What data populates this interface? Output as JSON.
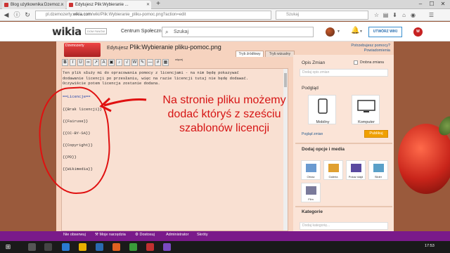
{
  "browser": {
    "tabs": [
      {
        "label": "Blog użytkownika:Dzemoz...",
        "active": false
      },
      {
        "label": "Edytujesz Plik:Wybieranie ...",
        "active": true
      }
    ],
    "newtab": "+",
    "window_min": "–",
    "window_max": "☐",
    "window_close": "✕",
    "url_prefix": "pl.dzemozerty.",
    "url_host": "wikia.com",
    "url_path": "/wiki/Plik:Wybieranie_pliku-pomoc.png?action=edit",
    "search_placeholder": "Szukaj"
  },
  "wikia": {
    "logo": "wikia",
    "fandom": "DOM FANÓW",
    "community": "Centrum Społeczności",
    "search_placeholder": "Szukaj",
    "create_button": "UTWÓRZ WIKI",
    "wikia_badge": "W"
  },
  "editor": {
    "wiki_thumb": "Dżemozerty",
    "editing_prefix": "Edytujesz",
    "page_title": "Plik:Wybieranie pliku-pomoc.png",
    "help1": "Potrzebujesz pomocy?",
    "help2": "Powiadomienia",
    "mode_source": "Tryb źródłowy",
    "mode_visual": "Tryb wizualny",
    "more": "więcej",
    "intro_lines": [
      "Ten plik służy mi do opracowania pomocy z licencjami - na nim będę pokazywać",
      "dodawanie licencji po przesłaniu, więc na razie licencji tutaj nie będę dodawać.",
      "Oczywiście potem licencja zostanie dodana."
    ],
    "heading": "==Licencje==",
    "licenses": [
      "{{Brak licencji}}",
      "{{Fairuse}}",
      "{{CC-BY-SA}}",
      "{{Copyright}}",
      "{{PD}}",
      "{{Wikimedia}}"
    ]
  },
  "annotation": {
    "lines": [
      "Na stronie pliku możemy",
      "dodać któryś z sześciu",
      "szablonów licencji"
    ]
  },
  "sidebar": {
    "summary_label": "Opis Zmian",
    "minor_label": "Drobna zmiana",
    "summary_placeholder": "Dodaj opis zmian",
    "preview_label": "Podgląd",
    "mobile": "Mobilny",
    "desktop": "Komputer",
    "preview_link": "Pogląd zmian",
    "publish": "Publikuj",
    "add_media": "Dodaj opcje i media",
    "media": [
      {
        "label": "Obraz",
        "color": "#6a9ad0"
      },
      {
        "label": "Galeria",
        "color": "#e0a030"
      },
      {
        "label": "Pokaz slajd",
        "color": "#5a4aa0"
      },
      {
        "label": "Slider",
        "color": "#5aa0c8"
      },
      {
        "label": "Film",
        "color": "#7a7a9a"
      }
    ],
    "categories": "Kategorie",
    "category_placeholder": "Dodaj kategorię..."
  },
  "statusbar": {
    "items": [
      "Nie obserwuj",
      "Moje narzędzia",
      "Dostosuj",
      "Administrator",
      "Skróty"
    ]
  },
  "taskbar": {
    "time": "17:53"
  }
}
